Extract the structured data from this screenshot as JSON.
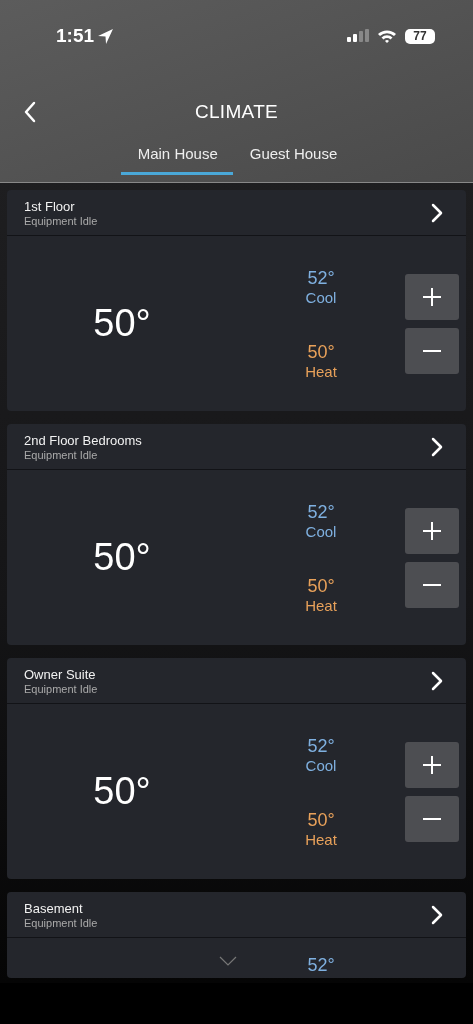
{
  "status_bar": {
    "time": "1:51",
    "battery": "77"
  },
  "header": {
    "title": "CLIMATE"
  },
  "tabs": [
    {
      "label": "Main House",
      "selected": true
    },
    {
      "label": "Guest House",
      "selected": false
    }
  ],
  "zones": [
    {
      "name": "1st Floor",
      "status": "Equipment Idle",
      "temperature": "50°",
      "cool": {
        "value": "52°",
        "label": "Cool"
      },
      "heat": {
        "value": "50°",
        "label": "Heat"
      }
    },
    {
      "name": "2nd Floor Bedrooms",
      "status": "Equipment Idle",
      "temperature": "50°",
      "cool": {
        "value": "52°",
        "label": "Cool"
      },
      "heat": {
        "value": "50°",
        "label": "Heat"
      }
    },
    {
      "name": "Owner Suite",
      "status": "Equipment Idle",
      "temperature": "50°",
      "cool": {
        "value": "52°",
        "label": "Cool"
      },
      "heat": {
        "value": "50°",
        "label": "Heat"
      }
    },
    {
      "name": "Basement",
      "status": "Equipment Idle",
      "cool": {
        "value": "52°"
      }
    }
  ]
}
